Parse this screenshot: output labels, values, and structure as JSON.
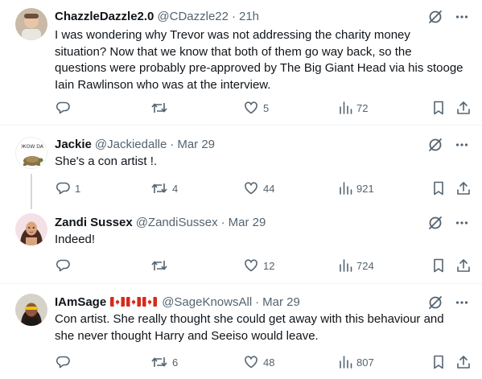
{
  "tweets": [
    {
      "name": "ChazzleDazzle2.0",
      "handle": "@CDazzle22",
      "time": "21h",
      "text": "I was wondering why Trevor was not addressing the charity money situation? Now that we know that both of them go way back, so the questions were probably pre-approved by The Big Giant Head via his stooge Iain Rawlinson who was at the interview.",
      "replies": "",
      "retweets": "",
      "likes": "5",
      "views": "72"
    },
    {
      "name": "Jackie",
      "handle": "@Jackiedalle",
      "time": "Mar 29",
      "avatar_text": "ЖOW DA",
      "text": "She's a con artist !.",
      "replies": "1",
      "retweets": "4",
      "likes": "44",
      "views": "921"
    },
    {
      "name": "Zandi Sussex",
      "handle": "@ZandiSussex",
      "time": "Mar 29",
      "text": "Indeed!",
      "replies": "",
      "retweets": "",
      "likes": "12",
      "views": "724"
    },
    {
      "name": "IAmSage",
      "handle": "@SageKnowsAll",
      "time": "Mar 29",
      "text": "Con artist. She really thought she could get away with this behaviour and she never thought Harry and Seeiso would leave.",
      "replies": "",
      "retweets": "6",
      "likes": "48",
      "views": "807"
    }
  ],
  "separator": "·",
  "colors": {
    "text": "#0f1419",
    "secondary": "#536471",
    "divider": "#eff3f4",
    "canada_red": "#d52b1e"
  },
  "icons": [
    "grok-slash-icon",
    "more-icon",
    "reply-icon",
    "retweet-icon",
    "like-icon",
    "views-icon",
    "bookmark-icon",
    "share-icon"
  ]
}
